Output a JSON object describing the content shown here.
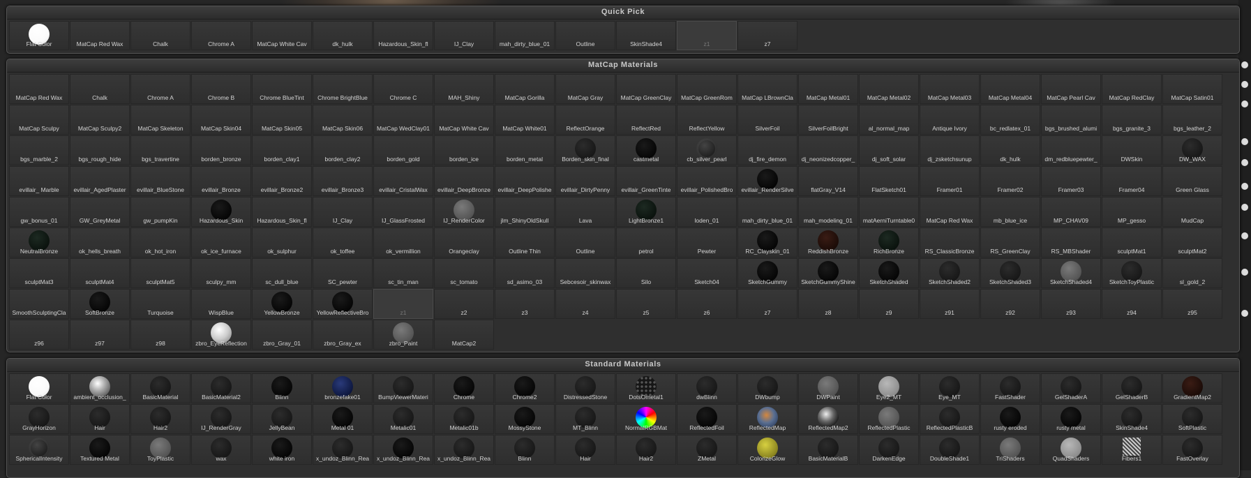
{
  "quick_pick": {
    "title": "Quick Pick",
    "items": [
      {
        "label": "Flat Color",
        "swatch": "white"
      },
      {
        "label": "MatCap Red Wax",
        "swatch": ""
      },
      {
        "label": "Chalk",
        "swatch": ""
      },
      {
        "label": "Chrome A",
        "swatch": ""
      },
      {
        "label": "MatCap White Cav",
        "swatch": ""
      },
      {
        "label": "dk_hulk",
        "swatch": ""
      },
      {
        "label": "Hazardous_Skin_fl",
        "swatch": ""
      },
      {
        "label": "IJ_Clay",
        "swatch": ""
      },
      {
        "label": "mah_dirty_blue_01",
        "swatch": ""
      },
      {
        "label": "Outline",
        "swatch": ""
      },
      {
        "label": "SkinShade4",
        "swatch": ""
      },
      {
        "label": "z1",
        "swatch": "",
        "dim": true,
        "selected": true
      },
      {
        "label": "z7",
        "swatch": ""
      }
    ]
  },
  "matcap_materials": {
    "title": "MatCap Materials",
    "items": [
      {
        "label": "MatCap Red Wax"
      },
      {
        "label": "Chalk"
      },
      {
        "label": "Chrome A"
      },
      {
        "label": "Chrome B"
      },
      {
        "label": "Chrome BlueTint"
      },
      {
        "label": "Chrome BrightBlue"
      },
      {
        "label": "Chrome C"
      },
      {
        "label": "MAH_Shiny"
      },
      {
        "label": "MatCap Gorilla"
      },
      {
        "label": "MatCap Gray"
      },
      {
        "label": "MatCap GreenClay"
      },
      {
        "label": "MatCap GreenRom"
      },
      {
        "label": "MatCap LBrownCla"
      },
      {
        "label": "MatCap Metal01"
      },
      {
        "label": "MatCap Metal02"
      },
      {
        "label": "MatCap Metal03"
      },
      {
        "label": "MatCap Metal04"
      },
      {
        "label": "MatCap Pearl Cav"
      },
      {
        "label": "MatCap RedClay"
      },
      {
        "label": "MatCap Satin01"
      },
      {
        "label": "MatCap Sculpy"
      },
      {
        "label": "MatCap Sculpy2"
      },
      {
        "label": "MatCap Skeleton"
      },
      {
        "label": "MatCap Skin04"
      },
      {
        "label": "MatCap Skin05"
      },
      {
        "label": "MatCap Skin06"
      },
      {
        "label": "MatCap WedClay01"
      },
      {
        "label": "MatCap White Cav"
      },
      {
        "label": "MatCap White01"
      },
      {
        "label": "ReflectOrange"
      },
      {
        "label": "ReflectRed"
      },
      {
        "label": "ReflectYellow"
      },
      {
        "label": "SilverFoil"
      },
      {
        "label": "SilverFoilBright"
      },
      {
        "label": "al_normal_map"
      },
      {
        "label": "Antique Ivory"
      },
      {
        "label": "bc_redlatex_01"
      },
      {
        "label": "bgs_brushed_alumi"
      },
      {
        "label": "bgs_granite_3"
      },
      {
        "label": "bgs_leather_2"
      },
      {
        "label": "bgs_marble_2"
      },
      {
        "label": "bgs_rough_hide"
      },
      {
        "label": "bgs_travertine"
      },
      {
        "label": "borden_bronze"
      },
      {
        "label": "borden_clay1"
      },
      {
        "label": "borden_clay2"
      },
      {
        "label": "borden_gold"
      },
      {
        "label": "borden_ice"
      },
      {
        "label": "borden_metal"
      },
      {
        "label": "Borden_skin_final",
        "swatch": "dark"
      },
      {
        "label": "castmetal",
        "swatch": "black"
      },
      {
        "label": "cb_silver_pearl",
        "swatch": "noise"
      },
      {
        "label": "dj_fire_demon"
      },
      {
        "label": "dj_neonizedcopper_"
      },
      {
        "label": "dj_soft_solar"
      },
      {
        "label": "dj_zsketchsunup"
      },
      {
        "label": "dk_hulk"
      },
      {
        "label": "dm_redbluepewter_"
      },
      {
        "label": "DWSkin"
      },
      {
        "label": "DW_WAX",
        "swatch": "dark"
      },
      {
        "label": "evillair_ Marble"
      },
      {
        "label": "evillair_AgedPlaster"
      },
      {
        "label": "evillair_BlueStone"
      },
      {
        "label": "evillair_Bronze"
      },
      {
        "label": "evillair_Bronze2"
      },
      {
        "label": "evillair_Bronze3"
      },
      {
        "label": "evillair_CristalWax"
      },
      {
        "label": "evillair_DeepBronze"
      },
      {
        "label": "evillair_DeepPolishe"
      },
      {
        "label": "evillair_DirtyPenny"
      },
      {
        "label": "evillair_GreenTinte"
      },
      {
        "label": "evillair_PolishedBro"
      },
      {
        "label": "evillair_RenderSilve",
        "swatch": "black"
      },
      {
        "label": "flatGray_V14"
      },
      {
        "label": "FlatSketch01"
      },
      {
        "label": "Framer01"
      },
      {
        "label": "Framer02"
      },
      {
        "label": "Framer03"
      },
      {
        "label": "Framer04"
      },
      {
        "label": "Green Glass"
      },
      {
        "label": "gw_bonus_01"
      },
      {
        "label": "GW_GreyMetal"
      },
      {
        "label": "gw_pumpKin"
      },
      {
        "label": "Hazardous_Skin",
        "swatch": "black"
      },
      {
        "label": "Hazardous_Skin_fl"
      },
      {
        "label": "IJ_Clay"
      },
      {
        "label": "IJ_GlassFrosted"
      },
      {
        "label": "IJ_RenderColor",
        "swatch": "gray"
      },
      {
        "label": "jlm_ShinyOldSkull"
      },
      {
        "label": "Lava"
      },
      {
        "label": "LightBronze1",
        "swatch": "green"
      },
      {
        "label": "loden_01"
      },
      {
        "label": "mah_dirty_blue_01"
      },
      {
        "label": "mah_modeling_01"
      },
      {
        "label": "matAerniTurntable0"
      },
      {
        "label": "MatCap Red Wax"
      },
      {
        "label": "mb_blue_ice"
      },
      {
        "label": "MP_CHAV09"
      },
      {
        "label": "MP_gesso"
      },
      {
        "label": "MudCap"
      },
      {
        "label": "NeutralBronze",
        "swatch": "green"
      },
      {
        "label": "ok_hells_breath"
      },
      {
        "label": "ok_hot_iron"
      },
      {
        "label": "ok_ice_furnace"
      },
      {
        "label": "ok_sulphur"
      },
      {
        "label": "ok_toffee"
      },
      {
        "label": "ok_vermillion"
      },
      {
        "label": "Orangeclay"
      },
      {
        "label": "Outline Thin"
      },
      {
        "label": "Outline"
      },
      {
        "label": "petrol"
      },
      {
        "label": "Pewter"
      },
      {
        "label": "RC_Clayskin_01",
        "swatch": "black"
      },
      {
        "label": "ReddishBronze",
        "swatch": "brown"
      },
      {
        "label": "RichBronze",
        "swatch": "green"
      },
      {
        "label": "RS_ClassicBronze"
      },
      {
        "label": "RS_GreenClay"
      },
      {
        "label": "RS_MBShader"
      },
      {
        "label": "sculptMat1"
      },
      {
        "label": "sculptMat2"
      },
      {
        "label": "sculptMat3"
      },
      {
        "label": "sculptMat4"
      },
      {
        "label": "sculptMat5"
      },
      {
        "label": "sculpy_mm"
      },
      {
        "label": "sc_dull_blue"
      },
      {
        "label": "SC_pewter"
      },
      {
        "label": "sc_tin_man"
      },
      {
        "label": "sc_tomato"
      },
      {
        "label": "sd_asimo_03"
      },
      {
        "label": "Sebcesoir_skinwax"
      },
      {
        "label": "Silo"
      },
      {
        "label": "Sketch04"
      },
      {
        "label": "SketchGummy",
        "swatch": "black"
      },
      {
        "label": "SketchGummyShine",
        "swatch": "black"
      },
      {
        "label": "SketchShaded",
        "swatch": "black"
      },
      {
        "label": "SketchShaded2",
        "swatch": "dark"
      },
      {
        "label": "SketchShaded3",
        "swatch": "dark"
      },
      {
        "label": "SketchShaded4",
        "swatch": "gray"
      },
      {
        "label": "SketchToyPlastic",
        "swatch": "dark"
      },
      {
        "label": "sl_gold_2"
      },
      {
        "label": "SmoothSculptingCla"
      },
      {
        "label": "SoftBronze",
        "swatch": "black"
      },
      {
        "label": "Turquoise"
      },
      {
        "label": "WispBlue"
      },
      {
        "label": "YellowBronze",
        "swatch": "black"
      },
      {
        "label": "YellowReflectiveBro",
        "swatch": "black"
      },
      {
        "label": "z1",
        "dim": true,
        "selected": true
      },
      {
        "label": "z2"
      },
      {
        "label": "z3"
      },
      {
        "label": "z4"
      },
      {
        "label": "z5"
      },
      {
        "label": "z6"
      },
      {
        "label": "z7"
      },
      {
        "label": "z8"
      },
      {
        "label": "z9"
      },
      {
        "label": "z91"
      },
      {
        "label": "z92"
      },
      {
        "label": "z93"
      },
      {
        "label": "z94"
      },
      {
        "label": "z95"
      },
      {
        "label": "z96"
      },
      {
        "label": "z97"
      },
      {
        "label": "z98"
      },
      {
        "label": "zbro_EyeReflection",
        "swatch": "silver"
      },
      {
        "label": "zbro_Gray_01"
      },
      {
        "label": "zbro_Gray_ex"
      },
      {
        "label": "zbro_Paint",
        "swatch": "gray"
      },
      {
        "label": "MatCap2"
      }
    ]
  },
  "standard_materials": {
    "title": "Standard Materials",
    "items": [
      {
        "label": "Flat Color",
        "swatch": "white"
      },
      {
        "label": "ambient_occlusion_",
        "swatch": "ao"
      },
      {
        "label": "BasicMaterial",
        "swatch": "dark"
      },
      {
        "label": "BasicMaterial2",
        "swatch": "dark"
      },
      {
        "label": "Blinn",
        "swatch": "black"
      },
      {
        "label": "bronzefake01",
        "swatch": "navy"
      },
      {
        "label": "BumpViewerMateri",
        "swatch": "dark"
      },
      {
        "label": "Chrome",
        "swatch": "black"
      },
      {
        "label": "Chrome2",
        "swatch": "black"
      },
      {
        "label": "DistressedStone",
        "swatch": "dark"
      },
      {
        "label": "DotsOmetal1",
        "swatch": "dots"
      },
      {
        "label": "dwBlinn",
        "swatch": "dark"
      },
      {
        "label": "DWbump",
        "swatch": "dark"
      },
      {
        "label": "DWPaint",
        "swatch": "gray"
      },
      {
        "label": "Eye2_MT",
        "swatch": "lgray"
      },
      {
        "label": "Eye_MT",
        "swatch": "dark"
      },
      {
        "label": "FastShader",
        "swatch": "dark"
      },
      {
        "label": "GelShaderA",
        "swatch": "dark"
      },
      {
        "label": "GelShaderB",
        "swatch": "dark"
      },
      {
        "label": "GradientMap2",
        "swatch": "brown"
      },
      {
        "label": "GrayHorizon",
        "swatch": "dark"
      },
      {
        "label": "Hair",
        "swatch": "dark"
      },
      {
        "label": "Hair2",
        "swatch": "dark"
      },
      {
        "label": "IJ_RenderGray",
        "swatch": "dark"
      },
      {
        "label": "JellyBean",
        "swatch": "dark"
      },
      {
        "label": "Metal 01",
        "swatch": "black"
      },
      {
        "label": "Metalic01",
        "swatch": "dark"
      },
      {
        "label": "Metalic01b",
        "swatch": "dark"
      },
      {
        "label": "MossyStone",
        "swatch": "black"
      },
      {
        "label": "MT_Blinn",
        "swatch": "dark"
      },
      {
        "label": "NormalRGBMat",
        "swatch": "rgb"
      },
      {
        "label": "ReflectedFoil",
        "swatch": "black"
      },
      {
        "label": "ReflectedMap",
        "swatch": "env"
      },
      {
        "label": "ReflectedMap2",
        "swatch": "chrome"
      },
      {
        "label": "ReflectedPlastic",
        "swatch": "gray"
      },
      {
        "label": "ReflectedPlasticB",
        "swatch": "dark"
      },
      {
        "label": "rusty eroded",
        "swatch": "black"
      },
      {
        "label": "rusty metal",
        "swatch": "black"
      },
      {
        "label": "SkinShade4",
        "swatch": "dark"
      },
      {
        "label": "SoftPlastic",
        "swatch": "dark"
      },
      {
        "label": "SphericalIntensity",
        "swatch": "noise"
      },
      {
        "label": "Textured Metal",
        "swatch": "black"
      },
      {
        "label": "ToyPlastic",
        "swatch": "gray"
      },
      {
        "label": "wax",
        "swatch": "dark"
      },
      {
        "label": "white iron",
        "swatch": "black"
      },
      {
        "label": "x_undoz_Blinn_Rea",
        "swatch": "dark"
      },
      {
        "label": "x_undoz_Blinn_Rea",
        "swatch": "black"
      },
      {
        "label": "x_undoz_Blinn_Rea",
        "swatch": "dark"
      },
      {
        "label": "Blinn",
        "swatch": "dark"
      },
      {
        "label": "Hair",
        "swatch": "dark"
      },
      {
        "label": "Hair2",
        "swatch": "dark"
      },
      {
        "label": "ZMetal",
        "swatch": "dark"
      },
      {
        "label": "ColorizeGlow",
        "swatch": "yellow"
      },
      {
        "label": "BasicMaterialB",
        "swatch": "dark"
      },
      {
        "label": "DarkenEdge",
        "swatch": "dark"
      },
      {
        "label": "DoubleShade1",
        "swatch": "dark"
      },
      {
        "label": "TriShaders",
        "swatch": "gray"
      },
      {
        "label": "QuadShaders",
        "swatch": "lgray"
      },
      {
        "label": "Fibers1",
        "swatch": "fibers"
      },
      {
        "label": "FastOverlay",
        "swatch": "dark"
      }
    ]
  }
}
